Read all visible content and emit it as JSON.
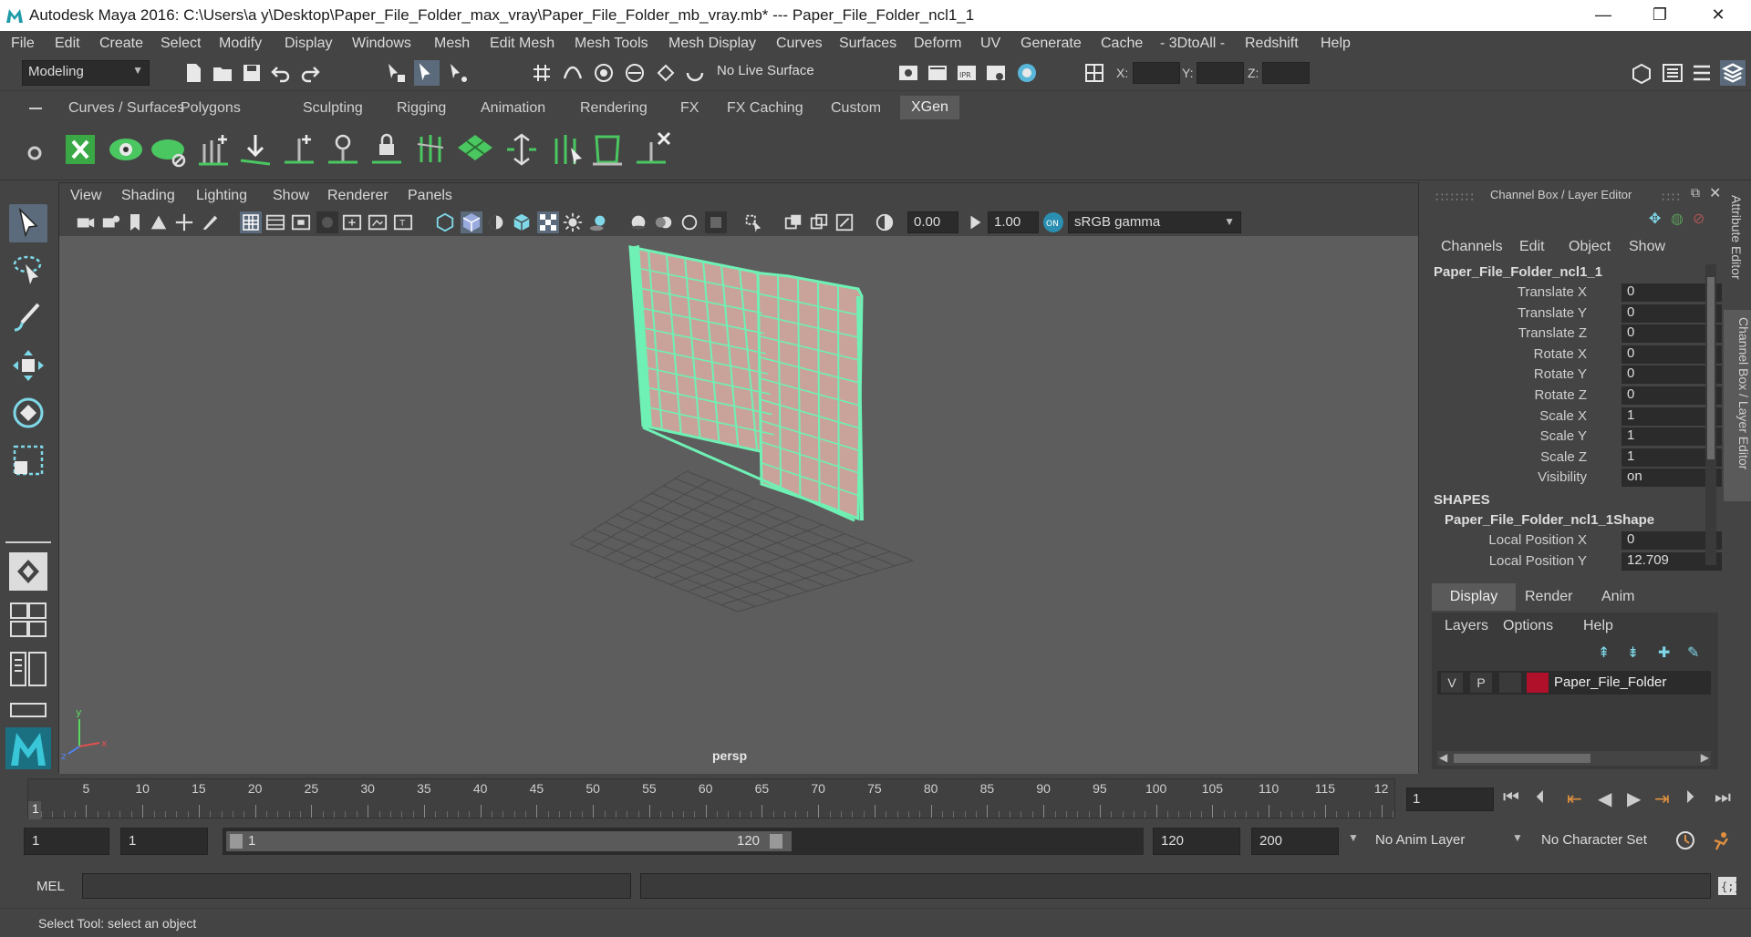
{
  "window": {
    "title": "Autodesk Maya 2016: C:\\Users\\a y\\Desktop\\Paper_File_Folder_max_vray\\Paper_File_Folder_mb_vray.mb*   ---   Paper_File_Folder_ncl1_1",
    "minimize": "—",
    "restore": "❐",
    "close": "✕"
  },
  "menubar": [
    "File",
    "Edit",
    "Create",
    "Select",
    "Modify",
    "Display",
    "Windows",
    "Mesh",
    "Edit Mesh",
    "Mesh Tools",
    "Mesh Display",
    "Curves",
    "Surfaces",
    "Deform",
    "UV",
    "Generate",
    "Cache",
    "- 3DtoAll -",
    "Redshift",
    "Help"
  ],
  "statusline": {
    "menuset": "Modeling",
    "live_surface": "No Live Surface",
    "x_label": "X:",
    "y_label": "Y:",
    "z_label": "Z:"
  },
  "shelf": {
    "tabs": [
      "Curves / Surfaces",
      "Polygons",
      "Sculpting",
      "Rigging",
      "Animation",
      "Rendering",
      "FX",
      "FX Caching",
      "Custom",
      "XGen"
    ],
    "active_tab": "XGen"
  },
  "viewport": {
    "menus": [
      "View",
      "Shading",
      "Lighting",
      "Show",
      "Renderer",
      "Panels"
    ],
    "exposure": "0.00",
    "gamma": "1.00",
    "color_space": "sRGB gamma",
    "camera": "persp",
    "wire_color": "#6ff0b4",
    "surface_color": "#c9a39a"
  },
  "channelbox": {
    "title": "Channel Box / Layer Editor",
    "menus": [
      "Channels",
      "Edit",
      "Object",
      "Show"
    ],
    "object_name": "Paper_File_Folder_ncl1_1",
    "attributes": [
      {
        "name": "Translate X",
        "value": "0"
      },
      {
        "name": "Translate Y",
        "value": "0"
      },
      {
        "name": "Translate Z",
        "value": "0"
      },
      {
        "name": "Rotate X",
        "value": "0"
      },
      {
        "name": "Rotate Y",
        "value": "0"
      },
      {
        "name": "Rotate Z",
        "value": "0"
      },
      {
        "name": "Scale X",
        "value": "1"
      },
      {
        "name": "Scale Y",
        "value": "1"
      },
      {
        "name": "Scale Z",
        "value": "1"
      },
      {
        "name": "Visibility",
        "value": "on"
      }
    ],
    "shapes_header": "SHAPES",
    "shape_name": "Paper_File_Folder_ncl1_1Shape",
    "shape_attributes": [
      {
        "name": "Local Position X",
        "value": "0"
      },
      {
        "name": "Local Position Y",
        "value": "12.709"
      }
    ],
    "layer_tabs": [
      "Display",
      "Render",
      "Anim"
    ],
    "active_layer_tab": "Display",
    "layer_menus": [
      "Layers",
      "Options",
      "Help"
    ],
    "layer": {
      "v": "V",
      "p": "P",
      "name": "Paper_File_Folder",
      "color": "#b0102a"
    }
  },
  "side_tabs": [
    "Attribute Editor",
    "Channel Box / Layer Editor"
  ],
  "timeline": {
    "ticks": [
      "5",
      "10",
      "15",
      "20",
      "25",
      "30",
      "35",
      "40",
      "45",
      "50",
      "55",
      "60",
      "65",
      "70",
      "75",
      "80",
      "85",
      "90",
      "95",
      "100",
      "105",
      "110",
      "115",
      "12"
    ],
    "current_frame_marker": "1",
    "current_frame": "1"
  },
  "range": {
    "start": "1",
    "playback_start": "1",
    "slider_start": "1",
    "slider_end": "120",
    "playback_end": "120",
    "end": "200",
    "anim_layer": "No Anim Layer",
    "character_set": "No Character Set"
  },
  "cmdline": {
    "lang": "MEL"
  },
  "helpline": {
    "text": "Select Tool: select an object"
  }
}
